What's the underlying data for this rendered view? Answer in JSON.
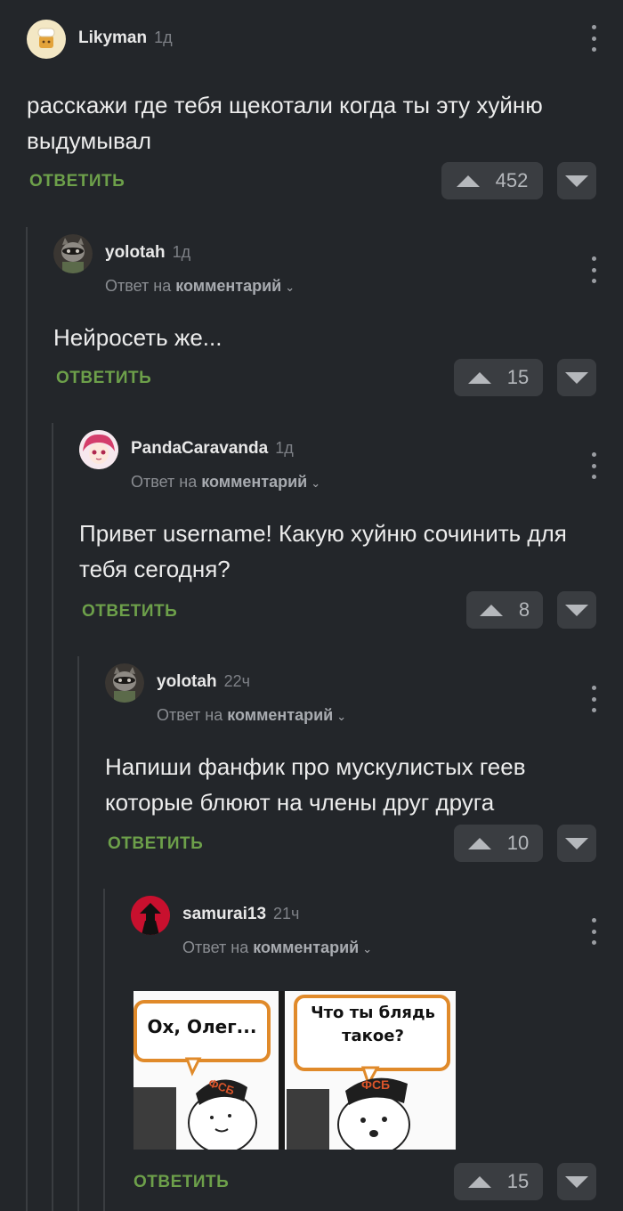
{
  "colors": {
    "background": "#23262a",
    "reply": "#6da04a",
    "vote_bg": "#3a3d41"
  },
  "comments": [
    {
      "author": "Likyman",
      "time": "1д",
      "text": "расскажи где тебя щекотали когда ты эту хуйню выдумывал",
      "reply_label": "ОТВЕТИТЬ",
      "votes": "452",
      "avatar_icon": "chef-avatar-icon"
    },
    {
      "author": "yolotah",
      "time": "1д",
      "reply_prefix": "Ответ на",
      "reply_target": "комментарий",
      "text": "Нейросеть же...",
      "reply_label": "ОТВЕТИТЬ",
      "votes": "15",
      "avatar_icon": "raccoon-avatar-icon"
    },
    {
      "author": "PandaCaravanda",
      "time": "1д",
      "reply_prefix": "Ответ на",
      "reply_target": "комментарий",
      "text": "Привет username! Какую хуйню сочинить для тебя сегодня?",
      "reply_label": "ОТВЕТИТЬ",
      "votes": "8",
      "avatar_icon": "anime-girl-avatar-icon"
    },
    {
      "author": "yolotah",
      "time": "22ч",
      "reply_prefix": "Ответ на",
      "reply_target": "комментарий",
      "text": "Напиши фанфик про мускулистых геев которые блюют на члены друг друга",
      "reply_label": "ОТВЕТИТЬ",
      "votes": "10",
      "avatar_icon": "raccoon-avatar-icon"
    },
    {
      "author": "samurai13",
      "time": "21ч",
      "reply_prefix": "Ответ на",
      "reply_target": "комментарий",
      "reply_label": "ОТВЕТИТЬ",
      "votes": "15",
      "avatar_icon": "samurai-avatar-icon",
      "meme": {
        "left_bubble": "Ох, Олег...",
        "right_bubble": "Что ты блядь такое?",
        "cap_text": "ФСБ"
      }
    }
  ]
}
